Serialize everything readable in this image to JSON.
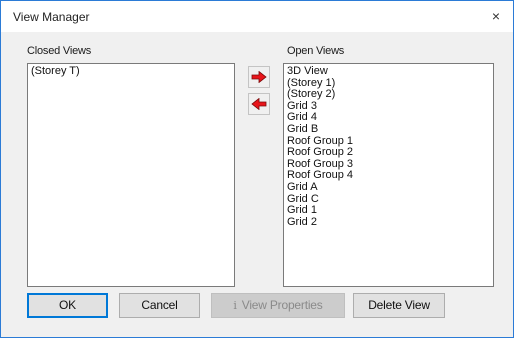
{
  "window": {
    "title": "View Manager",
    "close_glyph": "×"
  },
  "closed_views": {
    "label": "Closed Views",
    "items": [
      "(Storey T)"
    ]
  },
  "open_views": {
    "label": "Open Views",
    "items": [
      "3D View",
      "(Storey 1)",
      "(Storey 2)",
      "Grid 3",
      "Grid 4",
      "Grid B",
      "Roof Group 1",
      "Roof Group 2",
      "Roof Group 3",
      "Roof Group 4",
      "Grid A",
      "Grid C",
      "Grid 1",
      "Grid 2"
    ]
  },
  "transfer": {
    "move_right_icon": "red-arrow-right-icon",
    "move_left_icon": "red-arrow-left-icon",
    "arrow_color": "#e8141a"
  },
  "buttons": {
    "ok": "OK",
    "cancel": "Cancel",
    "view_properties": "View Properties",
    "view_properties_icon": "info-icon",
    "view_properties_icon_glyph": "i",
    "delete_view": "Delete View"
  },
  "colors": {
    "accent": "#0078d7",
    "window_border": "#2b7bd6",
    "dialog_bg": "#f0f0f0"
  }
}
